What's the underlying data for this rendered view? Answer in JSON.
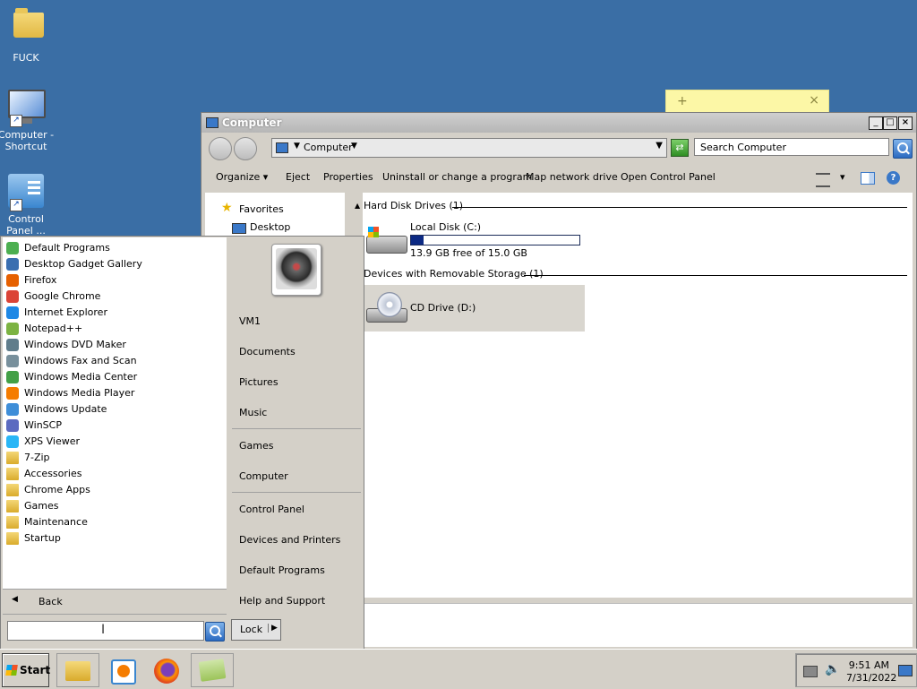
{
  "desktop": {
    "icons": [
      {
        "label": "FUCK"
      },
      {
        "label": "Computer - Shortcut"
      },
      {
        "label": "Control Panel ..."
      }
    ]
  },
  "sticky_note": {
    "add": "+",
    "close": "×"
  },
  "explorer": {
    "title": "Computer",
    "window_buttons": {
      "minimize": "_",
      "maximize": "□",
      "close": "×"
    },
    "address": {
      "crumb": "Computer"
    },
    "search": {
      "placeholder": "Search Computer"
    },
    "toolbar": {
      "organize": "Organize",
      "eject": "Eject",
      "properties": "Properties",
      "uninstall": "Uninstall or change a program",
      "map_drive": "Map network drive",
      "control_panel": "Open Control Panel"
    },
    "nav": {
      "favorites": "Favorites",
      "desktop": "Desktop"
    },
    "groups": {
      "hdd": "Hard Disk Drives (1)",
      "removable": "Devices with Removable Storage (1)"
    },
    "local_disk": {
      "name": "Local Disk (C:)",
      "free": "13.9 GB free of 15.0 GB",
      "used_fraction": 0.073
    },
    "cd_drive": {
      "name": "CD Drive (D:)"
    }
  },
  "start_menu": {
    "programs": [
      {
        "label": "Default Programs",
        "icon": "default-programs-icon",
        "color": "#4caf50"
      },
      {
        "label": "Desktop Gadget Gallery",
        "icon": "gadget-gallery-icon",
        "color": "#3a6fb0"
      },
      {
        "label": "Firefox",
        "icon": "firefox-icon",
        "color": "#e66000"
      },
      {
        "label": "Google Chrome",
        "icon": "chrome-icon",
        "color": "#db4437"
      },
      {
        "label": "Internet Explorer",
        "icon": "internet-explorer-icon",
        "color": "#1e88e5"
      },
      {
        "label": "Notepad++",
        "icon": "notepad-plus-plus-icon",
        "color": "#7cb342"
      },
      {
        "label": "Windows DVD Maker",
        "icon": "dvd-maker-icon",
        "color": "#607d8b"
      },
      {
        "label": "Windows Fax and Scan",
        "icon": "fax-scan-icon",
        "color": "#78909c"
      },
      {
        "label": "Windows Media Center",
        "icon": "media-center-icon",
        "color": "#43a047"
      },
      {
        "label": "Windows Media Player",
        "icon": "media-player-icon",
        "color": "#f57c00"
      },
      {
        "label": "Windows Update",
        "icon": "windows-update-icon",
        "color": "#3f8ed8"
      },
      {
        "label": "WinSCP",
        "icon": "winscp-icon",
        "color": "#5c6bc0"
      },
      {
        "label": "XPS Viewer",
        "icon": "xps-viewer-icon",
        "color": "#29b6f6"
      },
      {
        "label": "7-Zip",
        "icon": "folder-icon",
        "color": "#e1b843"
      },
      {
        "label": "Accessories",
        "icon": "folder-icon",
        "color": "#e1b843"
      },
      {
        "label": "Chrome Apps",
        "icon": "folder-icon",
        "color": "#e1b843"
      },
      {
        "label": "Games",
        "icon": "folder-icon",
        "color": "#e1b843"
      },
      {
        "label": "Maintenance",
        "icon": "folder-icon",
        "color": "#e1b843"
      },
      {
        "label": "Startup",
        "icon": "folder-icon",
        "color": "#e1b843"
      }
    ],
    "back": "Back",
    "lock": "Lock",
    "right": {
      "user": "VM1",
      "documents": "Documents",
      "pictures": "Pictures",
      "music": "Music",
      "games": "Games",
      "computer": "Computer",
      "control_panel": "Control Panel",
      "devices": "Devices and Printers",
      "default_programs": "Default Programs",
      "help": "Help and Support"
    }
  },
  "taskbar": {
    "start": "Start",
    "clock_time": "9:51 AM",
    "clock_date": "7/31/2022"
  }
}
